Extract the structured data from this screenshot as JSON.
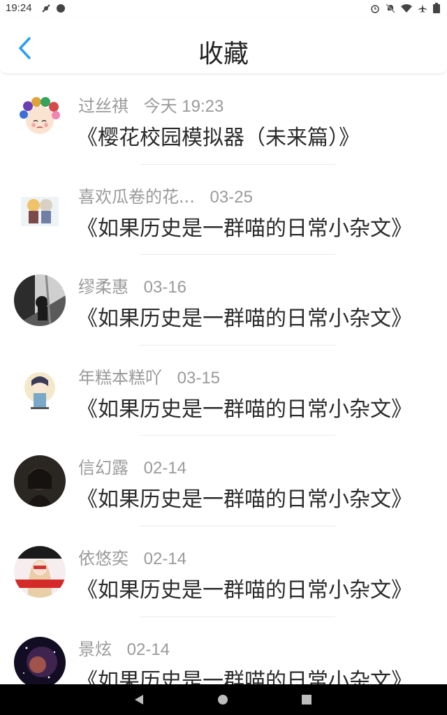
{
  "status_bar": {
    "time": "19:24"
  },
  "header": {
    "title": "收藏"
  },
  "items": [
    {
      "name": "过丝祺",
      "date": "今天 19:23",
      "title": "《樱花校园模拟器（未来篇）》"
    },
    {
      "name": "喜欢瓜卷的花...",
      "date": "03-25",
      "title": "《如果历史是一群喵的日常小杂文》"
    },
    {
      "name": "缪柔惠",
      "date": "03-16",
      "title": "《如果历史是一群喵的日常小杂文》"
    },
    {
      "name": "年糕本糕吖",
      "date": "03-15",
      "title": "《如果历史是一群喵的日常小杂文》"
    },
    {
      "name": "信幻露",
      "date": "02-14",
      "title": "《如果历史是一群喵的日常小杂文》"
    },
    {
      "name": "依悠奕",
      "date": "02-14",
      "title": "《如果历史是一群喵的日常小杂文》"
    },
    {
      "name": "景炫",
      "date": "02-14",
      "title": "《如果历史是一群喵的日常小杂文》"
    }
  ],
  "colors": {
    "accent": "#2a9df4",
    "meta_text": "#9a9a9a",
    "title_text": "#2b2b2b"
  },
  "icons": {
    "back": "chevron-left-icon",
    "nav_back": "triangle-back-icon",
    "nav_home": "circle-home-icon",
    "nav_recents": "square-recents-icon"
  }
}
